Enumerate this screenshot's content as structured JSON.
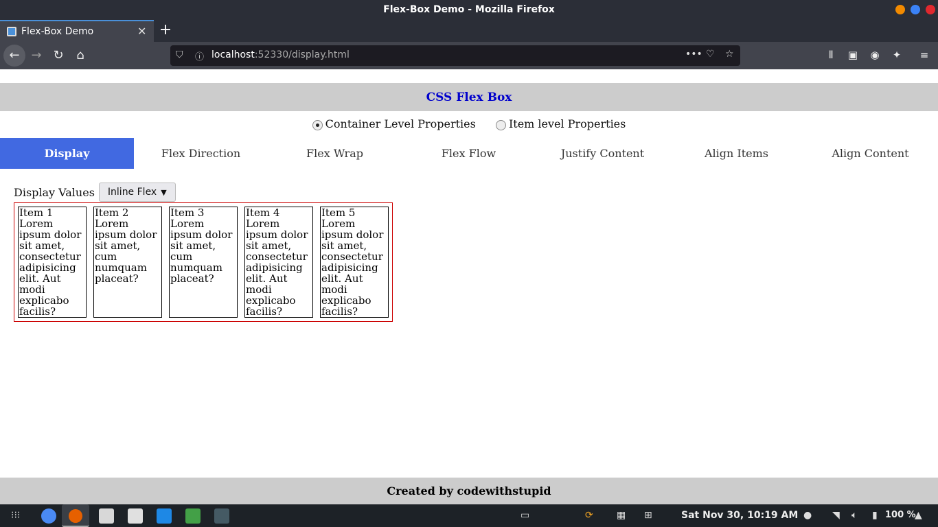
{
  "window": {
    "title": "Flex-Box Demo - Mozilla Firefox"
  },
  "tab": {
    "label": "Flex-Box Demo"
  },
  "urlbar": {
    "host": "localhost",
    "path": ":52330/display.html"
  },
  "page": {
    "heading": "CSS Flex Box",
    "radios": [
      {
        "label": "Container Level Properties",
        "checked": true
      },
      {
        "label": "Item level Properties",
        "checked": false
      }
    ],
    "nav": [
      "Display",
      "Flex Direction",
      "Flex Wrap",
      "Flex Flow",
      "Justify Content",
      "Align Items",
      "Align Content"
    ],
    "active_nav": "Display",
    "display_label": "Display Values",
    "display_select": "Inline Flex",
    "items": [
      "Item 1 Lorem ipsum dolor sit amet, consectetur adipisicing elit. Aut modi explicabo facilis?",
      "Item 2 Lorem ipsum dolor sit amet, cum numquam placeat?",
      "Item 3 Lorem ipsum dolor sit amet, cum numquam placeat?",
      "Item 4 Lorem ipsum dolor sit amet, consectetur adipisicing elit. Aut modi explicabo facilis?",
      "Item 5 Lorem ipsum dolor sit amet, consectetur adipisicing elit. Aut modi explicabo facilis?"
    ],
    "footer": "Created by codewithstupid"
  },
  "taskbar": {
    "clock": "Sat Nov 30, 10:19 AM",
    "battery": "100 %"
  },
  "colors": {
    "accent": "#4169e1",
    "heading": "#0000cc",
    "container_border": "#cc0000"
  }
}
